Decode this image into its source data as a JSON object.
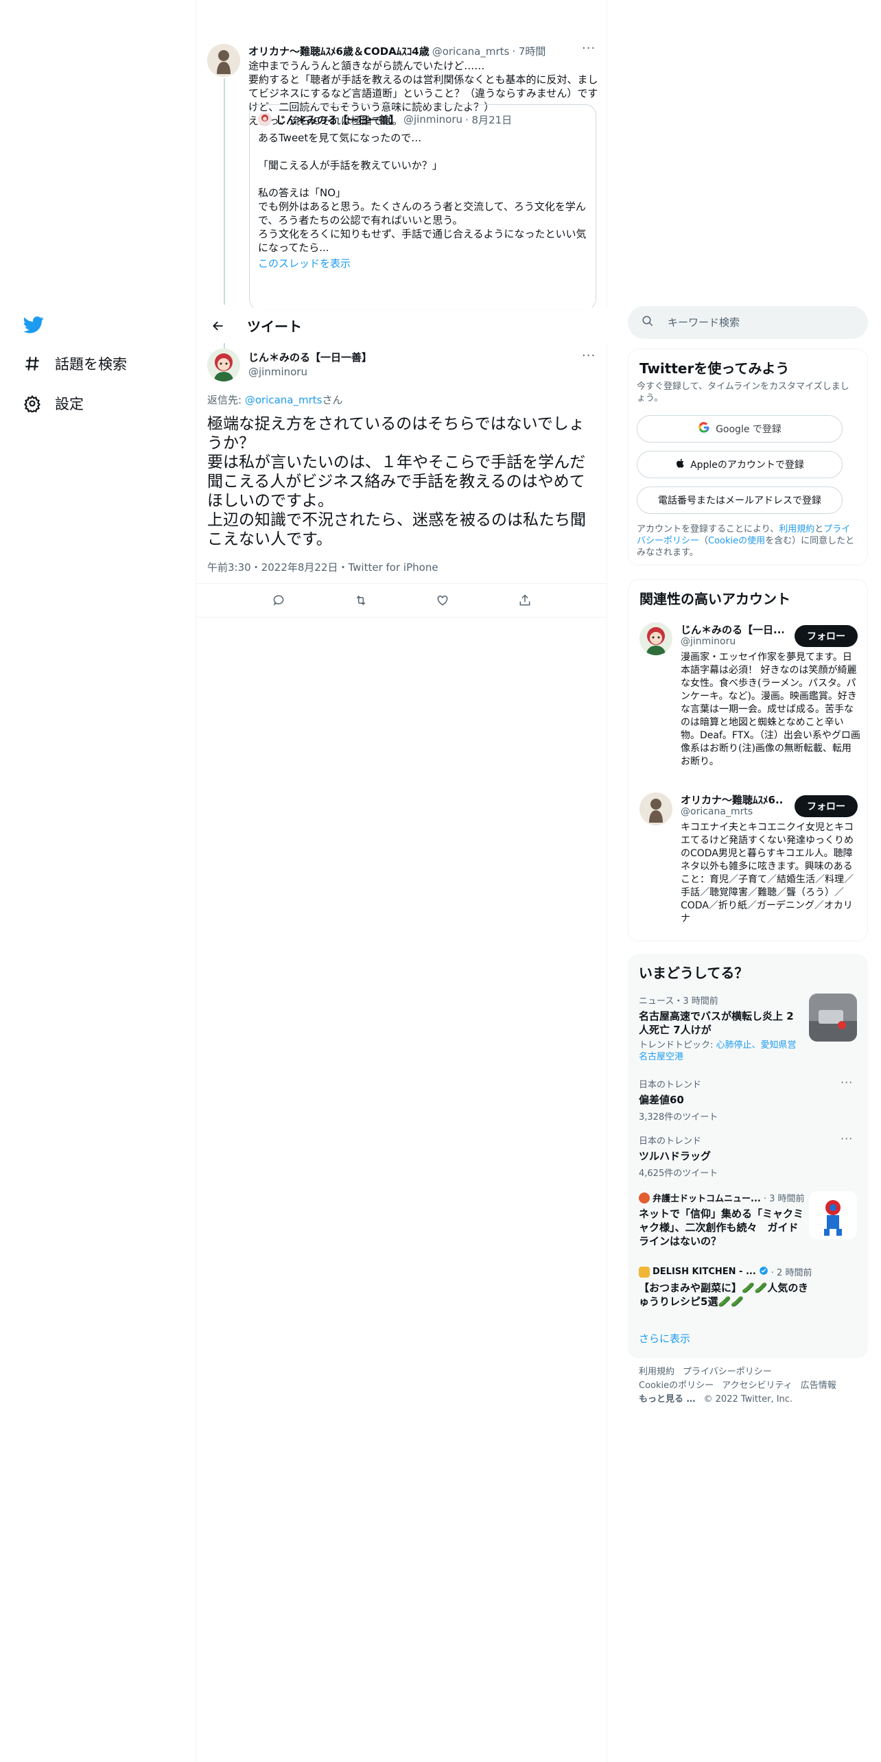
{
  "nav": {
    "explore_label": "話題を検索",
    "settings_label": "設定"
  },
  "parent_tweet": {
    "name": "オリカナ〜難聴ﾑｽﾒ6歳＆CODAﾑｽｺ4歳",
    "handle": "@oricana_mrts",
    "time": "· 7時間",
    "text": "途中までうんうんと頷きながら読んでいたけど……\n要約すると「聴者が手話を教えるのは営利関係なくとも基本的に反対、ましてビジネスにするなど言語道断」ということ？（違うならすみません）ですけど、二回読んでもそういう意味に読めましたよ？）\nええっ、流石にそれは極論では。",
    "quote": {
      "name": "じん＊みのる【一日一善】",
      "handle": "@jinminoru",
      "time": "· 8月21日",
      "text": "あるTweetを見て気になったので…\n\n「聞こえる人が手話を教えていいか？」\n\n私の答えは「NO」\nでも例外はあると思う。たくさんのろう者と交流して、ろう文化を学んで、ろう者たちの公認で有ればいいと思う。\nろう文化をろくに知りもせず、手話で通じ合えるようになったといい気になってたら...",
      "show_thread": "このスレッドを表示"
    }
  },
  "header": {
    "title": "ツイート"
  },
  "main_tweet": {
    "name": "じん＊みのる【一日一善】",
    "handle": "@jinminoru",
    "replying_prefix": "返信先: ",
    "replying_to": "@oricana_mrts",
    "replying_suffix": "さん",
    "text": "極端な捉え方をされているのはそちらではないでしょうか？\n要は私が言いたいのは、１年やそこらで手話を学んだ聞こえる人がビジネス絡みで手話を教えるのはやめてほしいのですよ。\n上辺の知識で不況されたら、迷惑を被るのは私たち聞こえない人です。",
    "timestamp": "午前3:30・2022年8月22日・Twitter for iPhone"
  },
  "search": {
    "placeholder": "キーワード検索"
  },
  "signup": {
    "title": "Twitterを使ってみよう",
    "subtitle": "今すぐ登録して、タイムラインをカスタマイズしましょう。",
    "google": "Google で登録",
    "apple": "Appleのアカウントで登録",
    "phone": "電話番号またはメールアドレスで登録",
    "terms_1": "アカウントを登録することにより、",
    "terms_link1": "利用規約",
    "terms_2": "と",
    "terms_link2": "プライバシーポリシー",
    "terms_3": "（",
    "terms_link3": "Cookieの使用",
    "terms_4": "を含む）に同意したとみなされます。"
  },
  "related": {
    "title": "関連性の高いアカウント",
    "accounts": [
      {
        "name": "じん＊みのる【一日...",
        "handle": "@jinminoru",
        "follow": "フォロー",
        "bio": "漫画家・エッセイ作家を夢見てます。日本語字幕は必須！ 好きなのは笑顔が綺麗な女性。食べ歩き(ラーメン。パスタ。パンケーキ。など)。漫画。映画鑑賞。好きな言葉は一期一会。成せば成る。苦手なのは暗算と地図と蜘蛛となめこと辛い物。Deaf。FTX。（注）出会い系やグロ画像系はお断り(注)画像の無断転載、転用お断り。"
      },
      {
        "name": "オリカナ〜難聴ﾑｽﾒ6...",
        "handle": "@oricana_mrts",
        "follow": "フォロー",
        "bio": "キコエナイ夫とキコエニクイ女児とキコエてるけど発語すくない発達ゆっくりめのCODA男児と暮らすキコエル人。聴障ネタ以外も雑多に呟きます。興味のあること：育児／子育て／結婚生活／料理／手話／聴覚障害／難聴／聾（ろう）／CODA／折り紙／ガーデニング／オカリナ"
      }
    ]
  },
  "trends": {
    "title": "いまどうしてる？",
    "items": [
      {
        "meta": "ニュース・3 時間前",
        "title": "名古屋高速でバスが横転し炎上 2人死亡 7人けが",
        "topic_prefix": "トレンドトピック: ",
        "topic": "心肺停止、愛知県営名古屋空港"
      },
      {
        "meta": "日本のトレンド",
        "title": "偏差値60",
        "count": "3,328件のツイート"
      },
      {
        "meta": "日本のトレンド",
        "title": "ツルハドラッグ",
        "count": "4,625件のツイート"
      },
      {
        "source": "弁護士ドットコムニュー...",
        "time": "· 3 時間前",
        "title": "ネットで「信仰」集める「ミャクミャク様」、二次創作も続々　ガイドラインはないの？"
      },
      {
        "source": "DELISH KITCHEN - ...",
        "time": "· 2 時間前",
        "title": "【おつまみや副菜に】🥒🥒人気のきゅうりレシピ5選🥒🥒"
      }
    ],
    "show_more": "さらに表示"
  },
  "footer": {
    "terms": "利用規約",
    "privacy": "プライバシーポリシー",
    "cookie": "Cookieのポリシー",
    "accessibility": "アクセシビリティ",
    "ads": "広告情報",
    "more": "もっと見る …",
    "copyright": "© 2022 Twitter, Inc."
  },
  "colors": {
    "accent": "#1d9bf0",
    "text": "#0f1419",
    "muted": "#536471",
    "border": "#eff3f4"
  }
}
